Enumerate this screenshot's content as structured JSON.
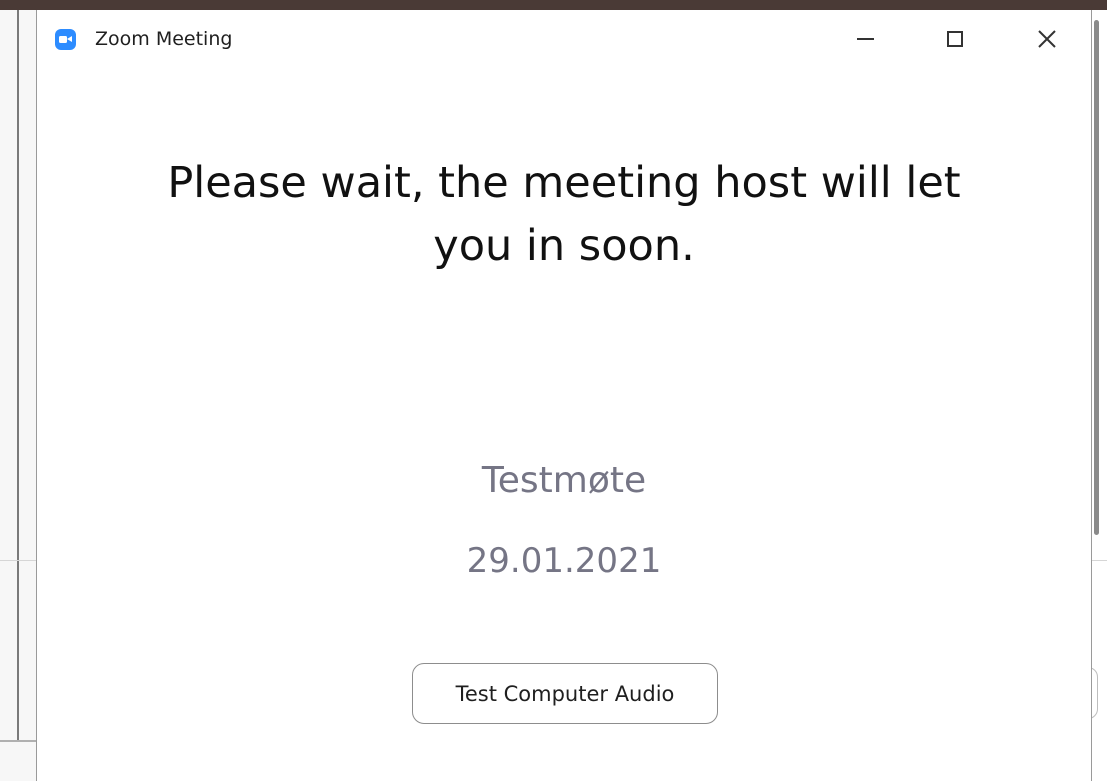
{
  "window": {
    "title": "Zoom Meeting",
    "app_icon": "zoom-camera-icon",
    "controls": {
      "minimize_icon": "minimize-icon",
      "maximize_icon": "maximize-icon",
      "close_icon": "close-icon",
      "close_glyph": "✕"
    }
  },
  "waiting_room": {
    "message_line1": "Please wait, the meeting host will let",
    "message_line2": "you in soon.",
    "meeting_name": "Testmøte",
    "meeting_date": "29.01.2021",
    "test_audio_label": "Test Computer Audio"
  },
  "colors": {
    "zoom_blue": "#2d8cff",
    "secondary_text": "#757585",
    "primary_text": "#111111"
  }
}
